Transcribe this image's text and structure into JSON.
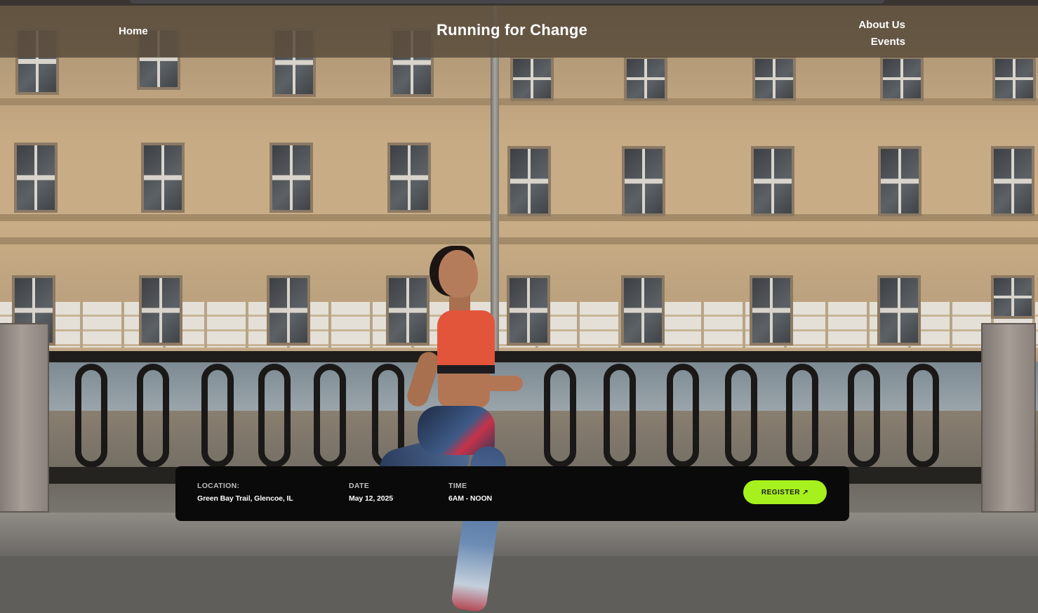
{
  "header": {
    "home_label": "Home",
    "site_title": "Running for Change",
    "about_label": "About Us",
    "events_label": "Events"
  },
  "event": {
    "location_label": "LOCATION:",
    "location_value": "Green Bay Trail, Glencoe, IL",
    "date_label": "DATE",
    "date_value": "May 12, 2025",
    "time_label": "TIME",
    "time_value": "6AM - NOON",
    "register_label": "REGISTER ↗"
  },
  "colors": {
    "header_overlay": "#5c4e3e",
    "card_background": "#0a0a0a",
    "register_accent": "#a6f01e"
  },
  "icons": {
    "register_arrow": "arrow-up-right-icon"
  }
}
